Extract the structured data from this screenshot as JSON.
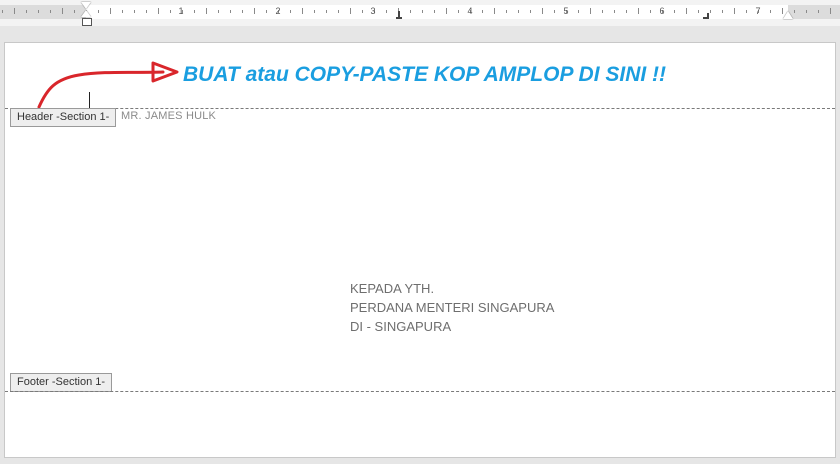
{
  "ruler": {
    "numbers": [
      "1",
      "2",
      "3",
      "4",
      "5",
      "6",
      "7"
    ]
  },
  "document": {
    "header_tab_label": "Header -Section 1-",
    "footer_tab_label": "Footer -Section 1-",
    "banner_text": "BUAT atau COPY-PASTE KOP AMPLOP DI SINI !!",
    "sender_name": "MR. JAMES HULK",
    "recipient": {
      "line1": "KEPADA YTH.",
      "line2": "PERDANA MENTERI SINGAPURA",
      "line3": "DI - SINGAPURA"
    },
    "arrow_icon": "red-curved-arrow-icon",
    "colors": {
      "banner": "#1a9ee0",
      "arrow": "#d9262b",
      "body_text": "#6e6e6e"
    }
  }
}
